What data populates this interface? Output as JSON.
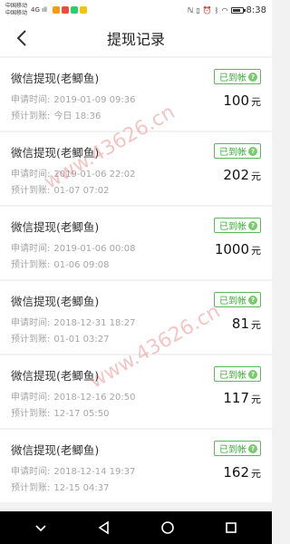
{
  "status_bar": {
    "carrier1": "中国移动",
    "carrier2": "中国移动",
    "signal_text": "4G ıll",
    "time": "8:38",
    "battery_level": 0.8,
    "app_icons": [
      "#f39c12",
      "#e74c3c",
      "#2ecc71",
      "#f1c40f"
    ]
  },
  "header": {
    "title": "提现记录"
  },
  "watermark": "www.43626.cn",
  "labels": {
    "apply_time": "申请时间:",
    "expected_arrival": "预计到账:",
    "unit": "元"
  },
  "records": [
    {
      "title": "微信提现(老鲫鱼)",
      "apply_time": "2019-01-09 09:36",
      "expected_arrival": "今日 18:36",
      "status": "已到帐",
      "amount": "100"
    },
    {
      "title": "微信提现(老鲫鱼)",
      "apply_time": "2019-01-06 22:02",
      "expected_arrival": "01-07 07:02",
      "status": "已到帐",
      "amount": "202"
    },
    {
      "title": "微信提现(老鲫鱼)",
      "apply_time": "2019-01-06 00:08",
      "expected_arrival": "01-06 09:08",
      "status": "已到帐",
      "amount": "1000"
    },
    {
      "title": "微信提现(老鲫鱼)",
      "apply_time": "2018-12-31 18:27",
      "expected_arrival": "01-01 03:27",
      "status": "已到帐",
      "amount": "81"
    },
    {
      "title": "微信提现(老鲫鱼)",
      "apply_time": "2018-12-16 20:50",
      "expected_arrival": "12-17 05:50",
      "status": "已到帐",
      "amount": "117"
    },
    {
      "title": "微信提现(老鲫鱼)",
      "apply_time": "2018-12-14 19:37",
      "expected_arrival": "12-15 04:37",
      "status": "已到帐",
      "amount": "162"
    }
  ],
  "colors": {
    "status_green": "#3aa93a",
    "background": "#f2f2f2",
    "navbar": "#000000"
  }
}
